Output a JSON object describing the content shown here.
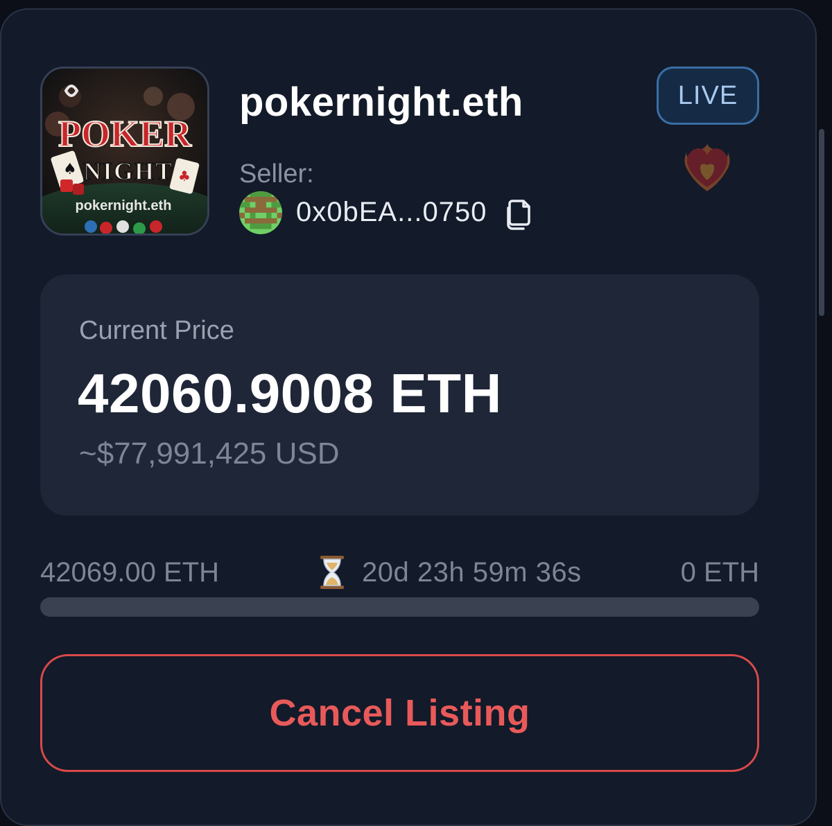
{
  "listing": {
    "name": "pokernight.eth",
    "thumbnail_logo_text": {
      "line1": "POKER",
      "line2": "NIGHT",
      "line3": "pokernight.eth"
    },
    "status_badge": "LIVE",
    "seller_label": "Seller:",
    "seller_address": "0x0bEA...0750",
    "icons": {
      "copy": "copy-icon",
      "favorite": "flaming-heart-icon",
      "timer": "hourglass-icon"
    }
  },
  "price": {
    "label": "Current Price",
    "value": "42060.9008 ETH",
    "usd": "~$77,991,425 USD"
  },
  "auction": {
    "start_price": "42069.00 ETH",
    "time_remaining": "20d 23h 59m 36s",
    "end_price": "0 ETH",
    "progress_fraction": 0.0
  },
  "actions": {
    "cancel_label": "Cancel Listing"
  },
  "colors": {
    "background": "#131a29",
    "price_box": "#1e2637",
    "badge_border": "#3a6ea5",
    "cancel_accent": "#e85a5a"
  }
}
